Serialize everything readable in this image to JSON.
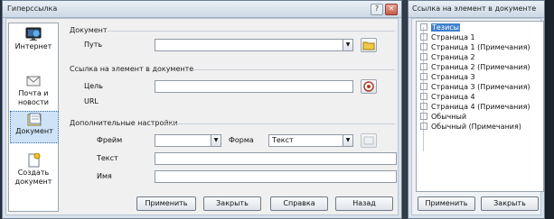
{
  "hyperlink_dialog": {
    "title": "Гиперссылка",
    "categories": [
      {
        "label": "Интернет"
      },
      {
        "label": "Почта и новости"
      },
      {
        "label": "Документ"
      },
      {
        "label": "Создать документ"
      }
    ],
    "document_section": "Документ",
    "path_label": "Путь",
    "target_section": "Ссылка на элемент в документе",
    "target_label": "Цель",
    "url_label": "URL",
    "extra_section": "Дополнительные настройки",
    "frame_label": "Фрейм",
    "form_label": "Форма",
    "form_value": "Текст",
    "text_label": "Текст",
    "name_label": "Имя",
    "buttons": {
      "apply": "Применить",
      "close": "Закрыть",
      "help": "Справка",
      "back": "Назад"
    }
  },
  "target_dialog": {
    "title": "Ссылка на элемент в документе",
    "items": [
      "Тезисы",
      "Страница 1",
      "Страница 1 (Примечания)",
      "Страница 2",
      "Страница 2 (Примечания)",
      "Страница 3",
      "Страница 3 (Примечания)",
      "Страница 4",
      "Страница 4 (Примечания)",
      "Обычный",
      "Обычный (Примечания)"
    ],
    "buttons": {
      "apply": "Применить",
      "close": "Закрыть"
    }
  },
  "icons": [
    "globe-monitor-icon",
    "mail-news-icon",
    "document-icon",
    "new-document-icon",
    "folder-icon",
    "target-icon",
    "frame-icon",
    "close-icon",
    "help-icon"
  ],
  "colors": {
    "selection": "#3f7fcf",
    "category_selection": "#cfe3f8"
  }
}
